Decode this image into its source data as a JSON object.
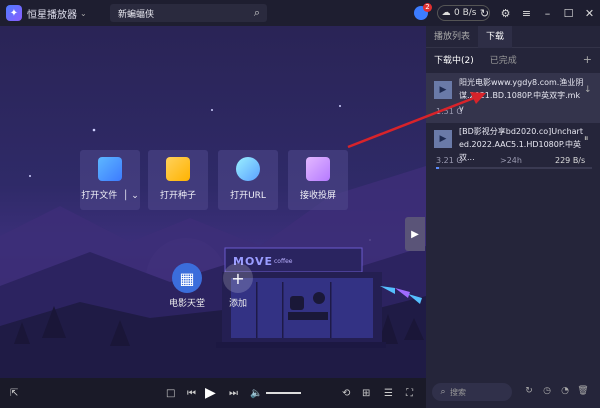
{
  "app": {
    "name": "恒星播放器"
  },
  "search": {
    "value": "新蝙蝠侠"
  },
  "user": {
    "badge": "2"
  },
  "speed": {
    "label": "0 B/s"
  },
  "actions": [
    {
      "label": "打开文件"
    },
    {
      "label": "打开种子"
    },
    {
      "label": "打开URL"
    },
    {
      "label": "接收投屏"
    }
  ],
  "extras": [
    {
      "label": "电影天堂"
    },
    {
      "label": "添加"
    }
  ],
  "scene": {
    "sign_text": "MOVE",
    "sign_sub": "coffee"
  },
  "panel": {
    "tabs": [
      "播放列表",
      "下载"
    ],
    "subtabs": [
      "下载中(2)",
      "已完成"
    ],
    "downloads": [
      {
        "name": "阳光电影www.ygdy8.com.渔业阴谋.2021.BD.1080P.中英双字.mkv",
        "size": "1.51 G",
        "eta": "",
        "rate": "",
        "progress": 0
      },
      {
        "name": "[BD影视分享bd2020.co]Uncharted.2022.AAC5.1.HD1080P.中英双...",
        "size": "3.21 G",
        "eta": ">24h",
        "rate": "229 B/s",
        "progress": 0.02
      }
    ],
    "search_placeholder": "搜索"
  }
}
